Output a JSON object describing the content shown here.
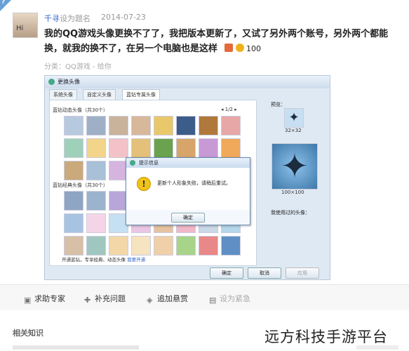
{
  "corner_badge": "?",
  "question": {
    "username": "千寻",
    "set_title_link": "设为题名",
    "date": "2014-07-23",
    "avatar_text": "Hi",
    "body": "我的QQ游戏头像更换不了了，我把版本更新了，又试了另外两个账号，另外两个都能换，就我的换不了，在另一个电脑也是这样",
    "reward": "100",
    "category": "分类：QQ游戏 - 给你"
  },
  "screenshot": {
    "window_title": "更换头像",
    "tabs": [
      "系统头像",
      "自定义头像",
      "蓝钻专属头像"
    ],
    "section1": "蓝钻动态头像（共30个）",
    "pager": "◂ 1/2 ▸",
    "section2": "蓝钻经典头像（共30个）",
    "footer_text": "开通蓝钻，专享经典、动态头像",
    "footer_link": "我要开通",
    "preview_label": "预览：",
    "small_size": "32×32",
    "big_size": "100×100",
    "used_label": "我使用过的头像：",
    "buttons": {
      "ok": "确定",
      "cancel": "取消",
      "apply": "应用"
    },
    "dialog": {
      "title": "提示信息",
      "message": "更新个人形象失败，请稍后重试。",
      "ok": "确定"
    }
  },
  "actions": [
    {
      "label": "求助专家",
      "icon": "expert-icon"
    },
    {
      "label": "补充问题",
      "icon": "plus-icon"
    },
    {
      "label": "追加悬赏",
      "icon": "reward-icon"
    },
    {
      "label": "设为紧急",
      "icon": "urgent-icon"
    }
  ],
  "related_title": "相关知识",
  "watermark": "远方科技手游平台",
  "colors": {
    "link": "#3366cc",
    "accent": "#6aa0d8",
    "coin": "#f0b21a"
  }
}
